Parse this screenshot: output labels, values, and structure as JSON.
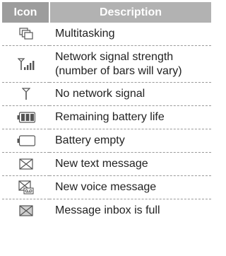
{
  "headers": {
    "icon": "Icon",
    "description": "Description"
  },
  "rows": [
    {
      "icon": "multitasking-icon",
      "description": "Multitasking"
    },
    {
      "icon": "network-signal-strength-icon",
      "description_line1": "Network signal strength",
      "description_line2": "(number of bars will vary)"
    },
    {
      "icon": "no-network-signal-icon",
      "description": "No network signal"
    },
    {
      "icon": "battery-full-icon",
      "description": "Remaining battery life"
    },
    {
      "icon": "battery-empty-icon",
      "description": "Battery empty"
    },
    {
      "icon": "new-text-message-icon",
      "description": "New text message"
    },
    {
      "icon": "new-voice-message-icon",
      "description": "New voice message"
    },
    {
      "icon": "inbox-full-icon",
      "description": "Message inbox is full"
    }
  ]
}
